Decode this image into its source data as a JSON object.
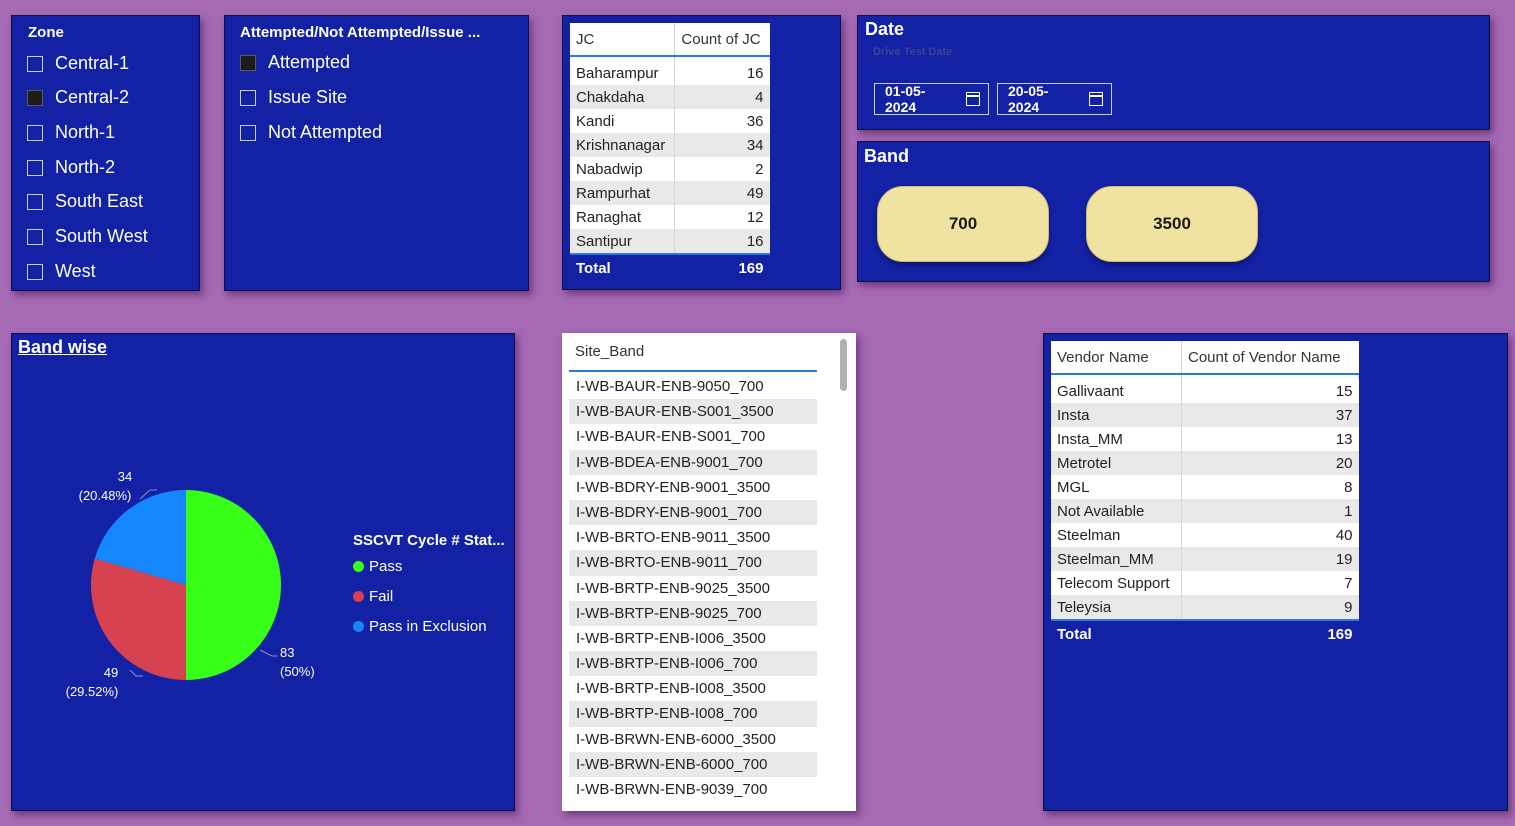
{
  "zone": {
    "title": "Zone",
    "items": [
      {
        "label": "Central-1",
        "checked": false
      },
      {
        "label": "Central-2",
        "checked": true
      },
      {
        "label": "North-1",
        "checked": false
      },
      {
        "label": "North-2",
        "checked": false
      },
      {
        "label": "South East",
        "checked": false
      },
      {
        "label": "South West",
        "checked": false
      },
      {
        "label": "West",
        "checked": false
      }
    ]
  },
  "status_slicer": {
    "title": "Attempted/Not Attempted/Issue ...",
    "items": [
      {
        "label": "Attempted",
        "checked": true
      },
      {
        "label": "Issue Site",
        "checked": false
      },
      {
        "label": "Not Attempted",
        "checked": false
      }
    ]
  },
  "jc_table": {
    "headers": [
      "JC",
      "Count of JC"
    ],
    "rows": [
      [
        "Baharampur",
        "16"
      ],
      [
        "Chakdaha",
        "4"
      ],
      [
        "Kandi",
        "36"
      ],
      [
        "Krishnanagar",
        "34"
      ],
      [
        "Nabadwip",
        "2"
      ],
      [
        "Rampurhat",
        "49"
      ],
      [
        "Ranaghat",
        "12"
      ],
      [
        "Santipur",
        "16"
      ]
    ],
    "total_label": "Total",
    "total_value": "169"
  },
  "date": {
    "title": "Date",
    "subtitle": "Drive Test Date",
    "start": "01-05-2024",
    "end": "20-05-2024"
  },
  "band": {
    "title": "Band",
    "options": [
      "700",
      "3500"
    ]
  },
  "band_wise": {
    "title": "Band wise",
    "legend_title": "SSCVT Cycle # Stat...",
    "colors": {
      "pass": "#37ff17",
      "fail": "#d6424f",
      "pass_in_exclusion": "#1686fc"
    },
    "labels": {
      "pass_value": "83",
      "pass_pct": "(50%)",
      "fail_value": "49",
      "fail_pct": "(29.52%)",
      "exclusion_value": "34",
      "exclusion_pct": "(20.48%)"
    }
  },
  "chart_data": {
    "type": "pie",
    "categories": [
      "Pass",
      "Fail",
      "Pass in Exclusion"
    ],
    "values": [
      83,
      49,
      34
    ],
    "percentages": [
      "50%",
      "29.52%",
      "20.48%"
    ],
    "legend": "right"
  },
  "site_band": {
    "header": "Site_Band",
    "rows": [
      "I-WB-BAUR-ENB-9050_700",
      "I-WB-BAUR-ENB-S001_3500",
      "I-WB-BAUR-ENB-S001_700",
      "I-WB-BDEA-ENB-9001_700",
      "I-WB-BDRY-ENB-9001_3500",
      "I-WB-BDRY-ENB-9001_700",
      "I-WB-BRTO-ENB-9011_3500",
      "I-WB-BRTO-ENB-9011_700",
      "I-WB-BRTP-ENB-9025_3500",
      "I-WB-BRTP-ENB-9025_700",
      "I-WB-BRTP-ENB-I006_3500",
      "I-WB-BRTP-ENB-I006_700",
      "I-WB-BRTP-ENB-I008_3500",
      "I-WB-BRTP-ENB-I008_700",
      "I-WB-BRWN-ENB-6000_3500",
      "I-WB-BRWN-ENB-6000_700",
      "I-WB-BRWN-ENB-9039_700"
    ]
  },
  "vendor_table": {
    "headers": [
      "Vendor Name",
      "Count of Vendor Name"
    ],
    "rows": [
      [
        "Gallivaant",
        "15"
      ],
      [
        "Insta",
        "37"
      ],
      [
        "Insta_MM",
        "13"
      ],
      [
        "Metrotel",
        "20"
      ],
      [
        "MGL",
        "8"
      ],
      [
        "Not Available",
        "1"
      ],
      [
        "Steelman",
        "40"
      ],
      [
        "Steelman_MM",
        "19"
      ],
      [
        "Telecom Support",
        "7"
      ],
      [
        "Teleysia",
        "9"
      ]
    ],
    "total_label": "Total",
    "total_value": "169"
  }
}
